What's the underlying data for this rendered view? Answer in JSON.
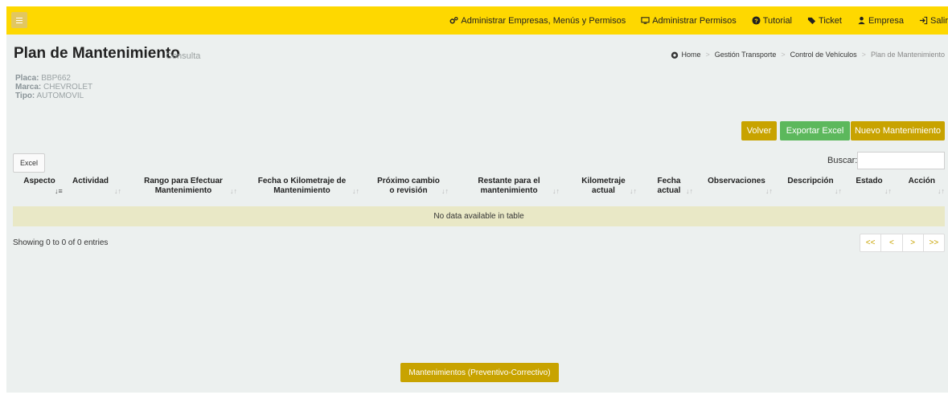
{
  "nav": {
    "items": [
      {
        "icon": "gears-icon",
        "label": "Administrar Empresas, Menús y Permisos"
      },
      {
        "icon": "desktop-icon",
        "label": "Administrar Permisos"
      },
      {
        "icon": "question-circle-icon",
        "label": "Tutorial"
      },
      {
        "icon": "tag-icon",
        "label": "Ticket"
      },
      {
        "icon": "user-icon",
        "label": "Empresa"
      },
      {
        "icon": "sign-out-icon",
        "label": "Salir"
      }
    ]
  },
  "header": {
    "title": "Plan de Mantenimiento",
    "subtitle": "Consulta"
  },
  "breadcrumb": {
    "home": "Home",
    "items": [
      "Gestión Transporte",
      "Control de Vehículos",
      "Plan de Mantenimiento"
    ]
  },
  "vehicle": {
    "placa_label": "Placa:",
    "placa": "BBP662",
    "marca_label": "Marca:",
    "marca": "CHEVROLET",
    "tipo_label": "Tipo:",
    "tipo": "AUTOMOVIL"
  },
  "actions": {
    "volver": "Volver",
    "exportar": "Exportar Excel",
    "nuevo": "Nuevo Mantenimiento"
  },
  "table": {
    "excel_button": "Excel",
    "search_label": "Buscar:",
    "search_value": "",
    "columns": [
      [
        "Aspecto"
      ],
      [
        "Actividad"
      ],
      [
        "Rango para Efectuar",
        "Mantenimiento"
      ],
      [
        "Fecha o Kilometraje de",
        "Mantenimiento"
      ],
      [
        "Próximo cambio",
        "o revisión"
      ],
      [
        "Restante para el",
        "mantenimiento"
      ],
      [
        "Kilometraje",
        "actual"
      ],
      [
        "Fecha",
        "actual"
      ],
      [
        "Observaciones"
      ],
      [
        "Descripción"
      ],
      [
        "Estado"
      ],
      [
        "Acción"
      ]
    ],
    "empty_message": "No data available in table",
    "info": "Showing 0 to 0 of 0 entries",
    "pager": [
      "<<",
      "<",
      ">",
      ">>"
    ]
  },
  "footer_button": "Mantenimientos (Preventivo-Correctivo)",
  "colors": {
    "topbar": "#fed800",
    "accent": "#c8a300",
    "success": "#5cb85c",
    "page_bg": "#ecf0ef"
  }
}
